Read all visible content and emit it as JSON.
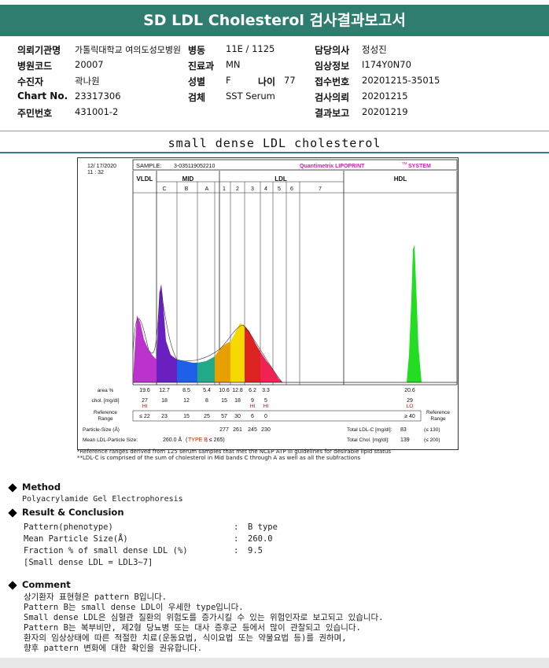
{
  "title": "SD LDL Cholesterol 검사결과보고서",
  "info": {
    "institution_label": "의뢰기관명",
    "institution": "가톨릭대학교 여의도성모병원",
    "ward_label": "병동",
    "ward": "11E / 1125",
    "doctor_label": "담당의사",
    "doctor": "정성진",
    "hospital_code_label": "병원코드",
    "hospital_code": "20007",
    "dept_label": "진료과",
    "dept": "MN",
    "clinical_label": "임상정보",
    "clinical": "I174Y0N70",
    "patient_label": "수진자",
    "patient": "곽나원",
    "sex_label": "성별",
    "sex": "F",
    "age_label": "나이",
    "age": "77",
    "receipt_label": "접수번호",
    "receipt": "20201215-35015",
    "chart_label": "Chart No.",
    "chart_no": "23317306",
    "specimen_label": "검체",
    "specimen": "SST Serum",
    "request_label": "검사의뢰",
    "request": "20201215",
    "resident_label": "주민번호",
    "resident": "431001-2",
    "report_label": "결과보고",
    "report": "20201219"
  },
  "section_title": "small dense LDL cholesterol",
  "chart_data": {
    "type": "area",
    "date": "12/ 17/2020",
    "time": "11 : 32",
    "sample_label": "SAMPLE:",
    "sample": "3-035119052210",
    "brand": "Quantimetrix LIPOPRINT",
    "brand_tm": "TM",
    "brand_suffix": "SYSTEM",
    "groups": [
      "VLDL",
      "MID",
      "LDL",
      "HDL"
    ],
    "bands": [
      "C",
      "B",
      "A",
      "1",
      "2",
      "3",
      "4",
      "5",
      "6",
      "7"
    ],
    "row_labels": {
      "area": "area %",
      "chol": "chol. [mg/dl]",
      "ref": "Reference Range",
      "ref_right": "Reference Range",
      "particle": "Particle-Size (Å)",
      "mean": "Mean LDL-Particle Size:",
      "total_ldl": "Total LDL-C [mg/dl]:",
      "total_chol": "Total Chol. [mg/dl]:"
    },
    "area_pct": [
      "19.6",
      "12.7",
      "8.5",
      "5.4",
      "10.6",
      "12.8",
      "6.2",
      "3.3",
      "20.6"
    ],
    "chol": [
      "27",
      "18",
      "12",
      "8",
      "15",
      "18",
      "9",
      "5",
      "29"
    ],
    "flags": [
      "HI",
      "",
      "",
      "",
      "",
      "",
      "HI",
      "HI",
      "LO"
    ],
    "ref_range": [
      "≤ 22",
      "23",
      "15",
      "25",
      "57",
      "30",
      "6",
      "0",
      "≥ 40"
    ],
    "particle_size": [
      "277",
      "261",
      "245",
      "230"
    ],
    "mean_particle": "260.0 Å",
    "type_b": "TYPE B",
    "type_suffix": "; ≤ 265)",
    "total_ldl": "83",
    "total_ldl_ref": "(≤ 130)",
    "total_chol": "139",
    "total_chol_ref": "(≤ 200)",
    "colors": {
      "vldl": "#bb33cc",
      "midc": "#6a1fc0",
      "midb": "#1e60e8",
      "mida": "#22aa88",
      "ldl1": "#e8a000",
      "ldl2": "#f5d800",
      "ldl3": "#dd2222",
      "ldl4": "#ee2255",
      "hdl": "#22dd22",
      "flag": "#dd0000",
      "brand": "#cc22aa",
      "type": "#cc2200"
    }
  },
  "footnotes": {
    "line1": "*Reference ranges derived from 125 serum samples that met the NCEP ATP III guidelines for desirable lipid status",
    "line2": "**LDL-C is comprised of the sum of cholesterol in Mid bands C through A as well as all the subfractions"
  },
  "method": {
    "title": "Method",
    "text": "Polyacrylamide Gel Electrophoresis"
  },
  "result": {
    "title": "Result & Conclusion",
    "rows": [
      {
        "label": "Pattern(phenotype)",
        "colon": ":",
        "value": "B type"
      },
      {
        "label": "Mean Particle Size(Å)",
        "colon": ":",
        "value": "260.0"
      },
      {
        "label": "Fraction % of small dense LDL (%)",
        "colon": ":",
        "value": "9.5"
      }
    ],
    "note": "[Small dense LDL = LDL3~7]"
  },
  "comment": {
    "title": "Comment",
    "lines": [
      "상기환자 표현형은 pattern B입니다.",
      "Pattern B는 small dense LDL이 우세한 type입니다.",
      "Small dense LDL은 심혈관 질환의 위험도를 증가시킬 수 있는 위험인자로 보고되고 있습니다.",
      "Pattern B는 복부비만, 제2형 당뇨병 또는 대사 증후군 등에서 많이 관찰되고 있습니다.",
      "환자의 임상상태에 따른 적절한 치료(운동요법, 식이요법 또는 약물요법 등)를 권하며,",
      "향후 pattern 변화에 대한 확인을 권유합니다."
    ]
  }
}
